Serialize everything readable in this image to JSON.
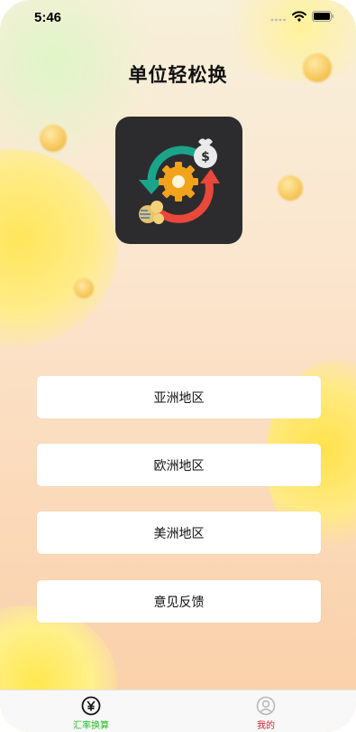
{
  "status_bar": {
    "time": "5:46"
  },
  "app": {
    "title": "单位轻松换"
  },
  "menu": {
    "items": [
      {
        "label": "亚洲地区"
      },
      {
        "label": "欧洲地区"
      },
      {
        "label": "美洲地区"
      },
      {
        "label": "意见反馈"
      }
    ]
  },
  "tab_bar": {
    "tabs": [
      {
        "label": "汇率换算",
        "icon": "yen-circle-icon",
        "active": true
      },
      {
        "label": "我的",
        "icon": "user-profile-icon",
        "active": false
      }
    ]
  },
  "colors": {
    "tab_active": "#22c022",
    "tab_inactive": "#c0272d",
    "logo_bg": "#2c2c2e",
    "arrow_green": "#1aa58a",
    "arrow_red": "#e9483b",
    "gear_orange": "#f3a21b"
  }
}
